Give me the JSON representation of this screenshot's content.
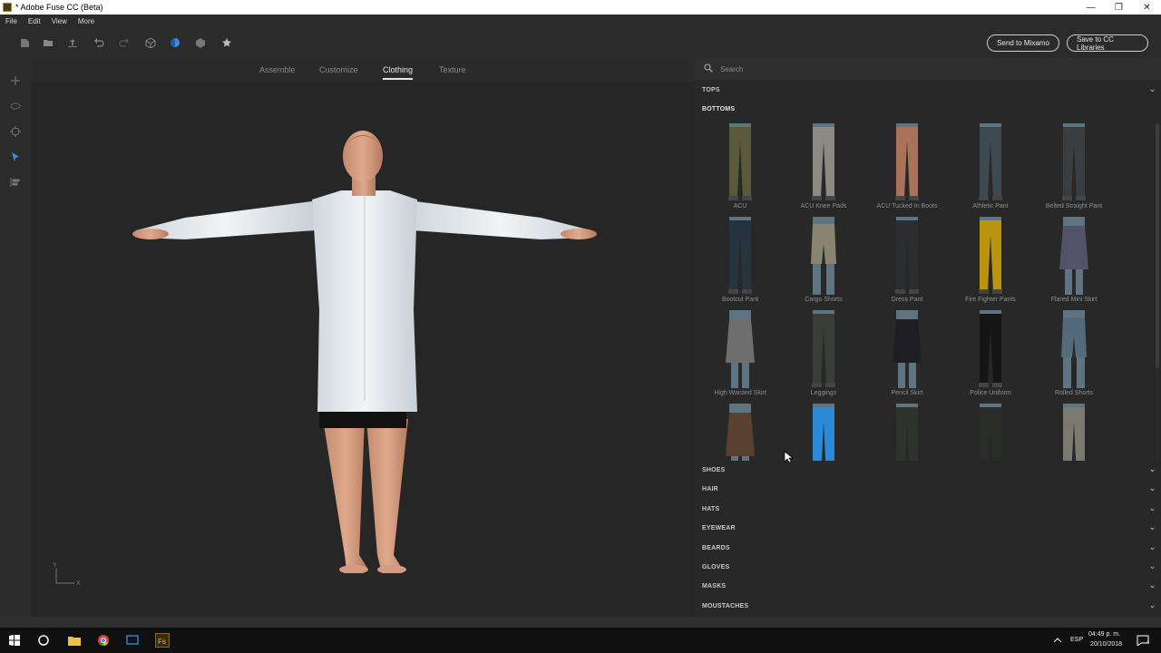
{
  "window": {
    "title": "* Adobe Fuse CC (Beta)"
  },
  "menu": [
    "File",
    "Edit",
    "View",
    "More"
  ],
  "toolbar": {
    "send_label": "Send to Mixamo",
    "save_label": "Save to CC Libraries"
  },
  "tabs": [
    {
      "label": "Assemble",
      "active": false
    },
    {
      "label": "Customize",
      "active": false
    },
    {
      "label": "Clothing",
      "active": true
    },
    {
      "label": "Texture",
      "active": false
    }
  ],
  "axis": {
    "y": "Y",
    "x": "X"
  },
  "search": {
    "placeholder": "Search"
  },
  "categories_top": {
    "label": "TOPS"
  },
  "bottoms": {
    "label": "BOTTOMS",
    "items": [
      {
        "name": "ACU",
        "color": "#5a5a3a",
        "style": "pants"
      },
      {
        "name": "ACU Knee Pads",
        "color": "#8a8a82",
        "style": "pants"
      },
      {
        "name": "ACU Tucked In Boots",
        "color": "#a8735a",
        "style": "pants"
      },
      {
        "name": "Athletic Pant",
        "color": "#3e4a52",
        "style": "pants"
      },
      {
        "name": "Belted Straight Pant",
        "color": "#3b3e40",
        "style": "pants"
      },
      {
        "name": "Bootcut Pant",
        "color": "#263440",
        "style": "pants"
      },
      {
        "name": "Cargo Shorts",
        "color": "#8a8470",
        "style": "shorts"
      },
      {
        "name": "Dress Pant",
        "color": "#2b2d2f",
        "style": "pants"
      },
      {
        "name": "Fire Fighter Pants",
        "color": "#b8940f",
        "style": "pants"
      },
      {
        "name": "Flared Mini Skirt",
        "color": "#545268",
        "style": "skirt"
      },
      {
        "name": "High Waisted Skirt",
        "color": "#6e6e6e",
        "style": "skirt"
      },
      {
        "name": "Leggings",
        "color": "#3a3d36",
        "style": "pants"
      },
      {
        "name": "Pencil Skirt",
        "color": "#1e1e22",
        "style": "skirt"
      },
      {
        "name": "Police Uniform",
        "color": "#151515",
        "style": "pants"
      },
      {
        "name": "Rolled Shorts",
        "color": "#526a7a",
        "style": "shorts"
      },
      {
        "name": "",
        "color": "#5a4030",
        "style": "skirt"
      },
      {
        "name": "",
        "color": "#2a8ad6",
        "style": "pants"
      },
      {
        "name": "",
        "color": "#2f332e",
        "style": "pants"
      },
      {
        "name": "",
        "color": "#2a2c2a",
        "style": "pants"
      },
      {
        "name": "",
        "color": "#7a7a72",
        "style": "pants"
      }
    ]
  },
  "categories": [
    "SHOES",
    "HAIR",
    "HATS",
    "EYEWEAR",
    "BEARDS",
    "GLOVES",
    "MASKS",
    "MOUSTACHES"
  ],
  "taskbar": {
    "lang": "ESP",
    "time": "04:49 p. m.",
    "date": "20/10/2018",
    "notif": "4"
  },
  "colors": {
    "accent": "#3a8ee6",
    "panel": "#282828",
    "viewport": "#262626"
  }
}
